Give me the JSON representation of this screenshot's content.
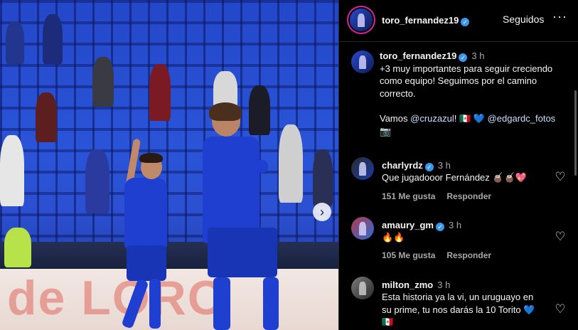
{
  "post": {
    "username": "toro_fernandez19",
    "follow_label": "Seguidos",
    "more_label": "···",
    "photo_board_text": "de LORO",
    "next_arrow": "›"
  },
  "caption": {
    "username": "toro_fernandez19",
    "time": "3 h",
    "line1": "+3 muy importantes para seguir creciendo",
    "line2": "como equipo! Seguimos por el camino",
    "line3": "correcto.",
    "vamos": "Vamos",
    "mention1": "@cruzazul",
    "mid": "! 🇲🇽 💙",
    "mention2": "@edgardc_fotos",
    "trail": "📷"
  },
  "comments": [
    {
      "username": "charlyrdz",
      "time": "3 h",
      "verified": true,
      "text": "Que jugadooor Fernández 🧉🧉💖",
      "likes": "151 Me gusta",
      "reply": "Responder"
    },
    {
      "username": "amaury_gm",
      "time": "3 h",
      "verified": true,
      "text": "🔥🔥",
      "likes": "105 Me gusta",
      "reply": "Responder"
    },
    {
      "username": "milton_zmo",
      "time": "3 h",
      "verified": false,
      "text_line1": "Esta historia ya la vi, un uruguayo en",
      "text_line2": "su prime, tu nos darás la 10 Torito 💙",
      "trail": "🇲🇽"
    }
  ],
  "icons": {
    "verified": "✓",
    "heart": "♡"
  },
  "colors": {
    "background": "#000000",
    "verified_blue": "#3897f0",
    "secondary_text": "#a8a8a8",
    "divider": "#262626"
  }
}
